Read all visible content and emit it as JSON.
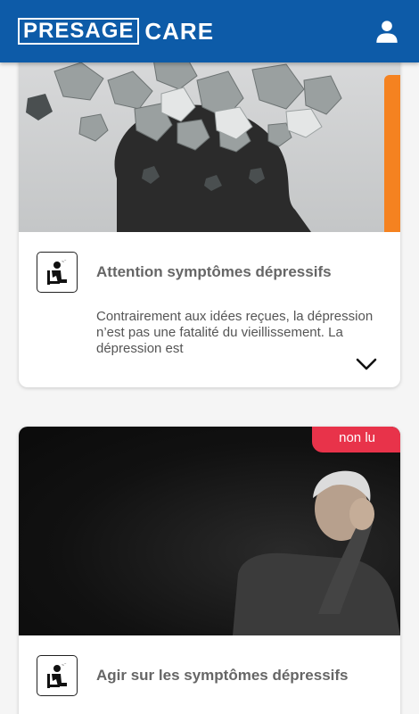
{
  "header": {
    "logo_boxed": "PRESAGE",
    "logo_text": "CARE",
    "account_icon": "user-icon",
    "background_color": "#0d5ba8"
  },
  "cards": [
    {
      "title": "Attention symptômes dépressifs",
      "excerpt": "Contrairement aux idées reçues, la dépression n’est pas une fatalité du vieillissement. La dépression est",
      "category_icon": "depressed-person-icon",
      "image_subject": "crumpled paper above head silhouette",
      "accent_color": "#f58220",
      "expand_icon": "chevron-down-icon"
    },
    {
      "title": "Agir sur les symptômes dépressifs",
      "badge": "non lu",
      "badge_color": "#e8334a",
      "category_icon": "depressed-person-icon",
      "image_subject": "elderly man holding his head in dark room"
    }
  ]
}
